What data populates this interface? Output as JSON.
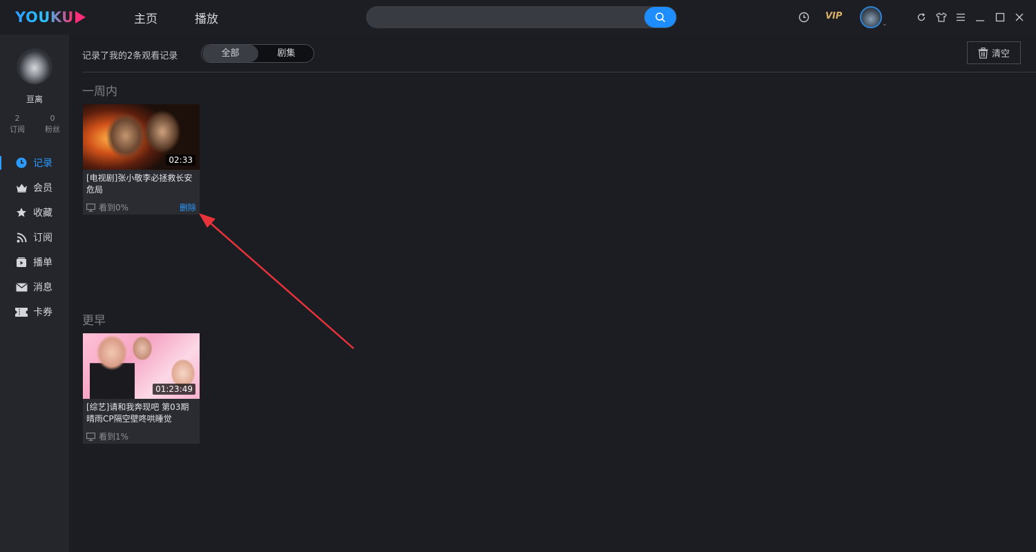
{
  "app": {
    "logo": "YOUKU"
  },
  "nav": {
    "tabs": [
      {
        "label": "主页"
      },
      {
        "label": "播放"
      }
    ]
  },
  "search": {
    "value": "",
    "placeholder": ""
  },
  "topbar": {
    "vip_label": "VIP"
  },
  "user": {
    "name": "亘离",
    "subscriptions_count": "2",
    "subscriptions_label": "订阅",
    "fans_count": "0",
    "fans_label": "粉丝"
  },
  "sidebar": {
    "items": [
      {
        "label": "记录",
        "icon": "clock-icon",
        "active": true
      },
      {
        "label": "会员",
        "icon": "crown-icon",
        "active": false
      },
      {
        "label": "收藏",
        "icon": "star-icon",
        "active": false
      },
      {
        "label": "订阅",
        "icon": "rss-icon",
        "active": false
      },
      {
        "label": "播单",
        "icon": "playlist-icon",
        "active": false
      },
      {
        "label": "消息",
        "icon": "mail-icon",
        "active": false
      },
      {
        "label": "卡券",
        "icon": "ticket-icon",
        "active": false
      }
    ]
  },
  "history": {
    "summary": "记录了我的2条观看记录",
    "filters": [
      {
        "label": "全部",
        "selected": true
      },
      {
        "label": "剧集",
        "selected": false
      }
    ],
    "clear_label": "清空",
    "sections": [
      {
        "title": "一周内",
        "items": [
          {
            "title": "[电视剧]张小敬李必拯救长安危局",
            "duration": "02:33",
            "progress": "看到0%",
            "delete_label": "删除"
          }
        ]
      },
      {
        "title": "更早",
        "items": [
          {
            "title": "[综艺]请和我奔现吧 第03期 晴雨CP隔空壁咚哄睡觉",
            "duration": "01:23:49",
            "progress": "看到1%"
          }
        ]
      }
    ]
  },
  "colors": {
    "accent": "#2a9bff",
    "vip": "#d9b068",
    "annotation_arrow": "#e8333a"
  }
}
